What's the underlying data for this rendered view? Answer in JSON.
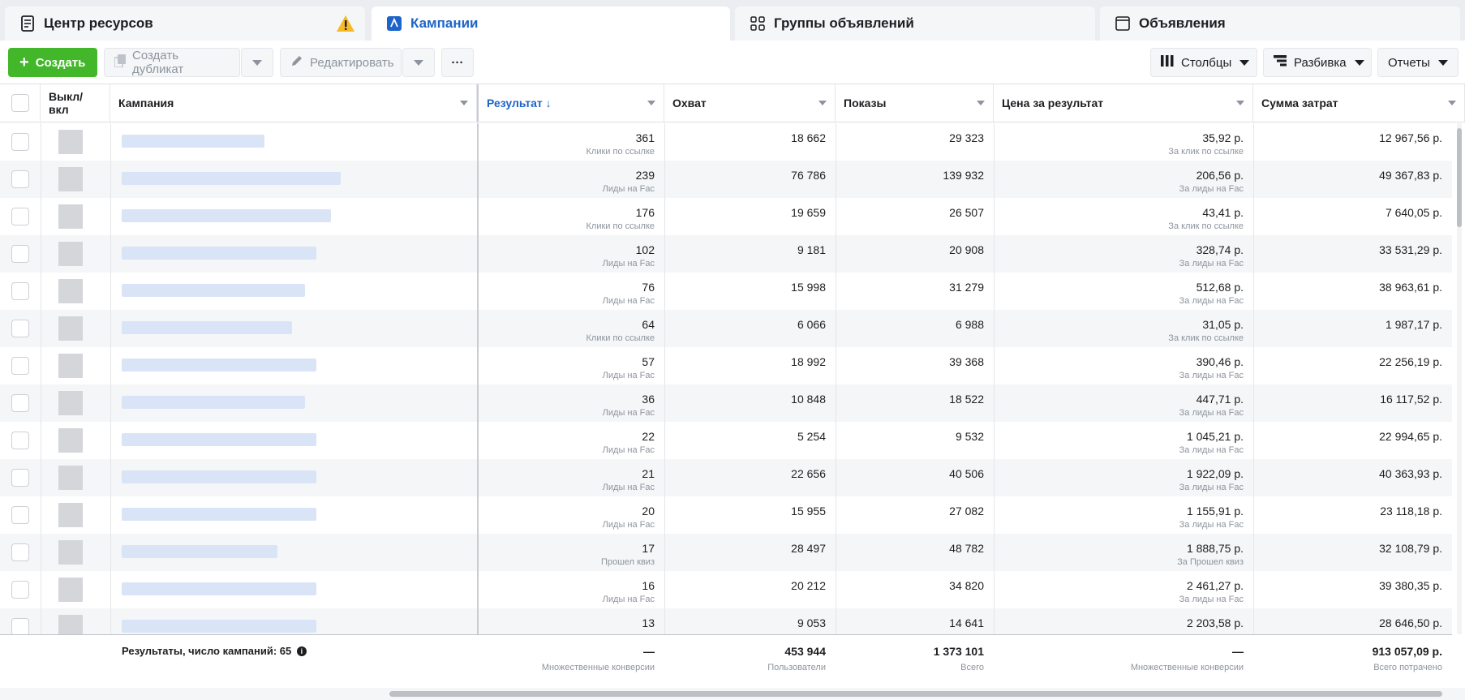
{
  "tabs": [
    {
      "label": "Центр ресурсов",
      "icon": "document-icon"
    },
    {
      "label": "Кампании",
      "icon": "campaign-icon"
    },
    {
      "label": "Группы объявлений",
      "icon": "grid-icon"
    },
    {
      "label": "Объявления",
      "icon": "ad-icon"
    }
  ],
  "toolbar": {
    "create": "Создать",
    "duplicate": "Создать дубликат",
    "edit": "Редактировать",
    "more": "···",
    "columns": "Столбцы",
    "breakdown": "Разбивка",
    "reports": "Отчеты"
  },
  "columns": {
    "toggle": "Выкл/\nвкл",
    "campaign": "Кампания",
    "result": "Результат ↓",
    "reach": "Охват",
    "impressions": "Показы",
    "cost": "Цена за результат",
    "spend": "Сумма затрат"
  },
  "rows": [
    {
      "result": "361",
      "result_type": "Клики по ссылке",
      "reach": "18 662",
      "impressions": "29 323",
      "cost": "35,92 р.",
      "cost_type": "За клик по ссылке",
      "spend": "12 967,56 р."
    },
    {
      "result": "239",
      "result_type": "Лиды на Fac",
      "reach": "76 786",
      "impressions": "139 932",
      "cost": "206,56 р.",
      "cost_type": "За лиды на Fac",
      "spend": "49 367,83 р."
    },
    {
      "result": "176",
      "result_type": "Клики по ссылке",
      "reach": "19 659",
      "impressions": "26 507",
      "cost": "43,41 р.",
      "cost_type": "За клик по ссылке",
      "spend": "7 640,05 р."
    },
    {
      "result": "102",
      "result_type": "Лиды на Fac",
      "reach": "9 181",
      "impressions": "20 908",
      "cost": "328,74 р.",
      "cost_type": "За лиды на Fac",
      "spend": "33 531,29 р."
    },
    {
      "result": "76",
      "result_type": "Лиды на Fac",
      "reach": "15 998",
      "impressions": "31 279",
      "cost": "512,68 р.",
      "cost_type": "За лиды на Fac",
      "spend": "38 963,61 р."
    },
    {
      "result": "64",
      "result_type": "Клики по ссылке",
      "reach": "6 066",
      "impressions": "6 988",
      "cost": "31,05 р.",
      "cost_type": "За клик по ссылке",
      "spend": "1 987,17 р."
    },
    {
      "result": "57",
      "result_type": "Лиды на Fac",
      "reach": "18 992",
      "impressions": "39 368",
      "cost": "390,46 р.",
      "cost_type": "За лиды на Fac",
      "spend": "22 256,19 р."
    },
    {
      "result": "36",
      "result_type": "Лиды на Fac",
      "reach": "10 848",
      "impressions": "18 522",
      "cost": "447,71 р.",
      "cost_type": "За лиды на Fac",
      "spend": "16 117,52 р."
    },
    {
      "result": "22",
      "result_type": "Лиды на Fac",
      "reach": "5 254",
      "impressions": "9 532",
      "cost": "1 045,21 р.",
      "cost_type": "За лиды на Fac",
      "spend": "22 994,65 р."
    },
    {
      "result": "21",
      "result_type": "Лиды на Fac",
      "reach": "22 656",
      "impressions": "40 506",
      "cost": "1 922,09 р.",
      "cost_type": "За лиды на Fac",
      "spend": "40 363,93 р."
    },
    {
      "result": "20",
      "result_type": "Лиды на Fac",
      "reach": "15 955",
      "impressions": "27 082",
      "cost": "1 155,91 р.",
      "cost_type": "За лиды на Fac",
      "spend": "23 118,18 р."
    },
    {
      "result": "17",
      "result_type": "Прошел квиз",
      "reach": "28 497",
      "impressions": "48 782",
      "cost": "1 888,75 р.",
      "cost_type": "За Прошел квиз",
      "spend": "32 108,79 р."
    },
    {
      "result": "16",
      "result_type": "Лиды на Fac",
      "reach": "20 212",
      "impressions": "34 820",
      "cost": "2 461,27 р.",
      "cost_type": "За лиды на Fac",
      "spend": "39 380,35 р."
    },
    {
      "result": "13",
      "result_type": "",
      "reach": "9 053",
      "impressions": "14 641",
      "cost": "2 203,58 р.",
      "cost_type": "",
      "spend": "28 646,50 р."
    }
  ],
  "footer": {
    "label": "Результаты, число кампаний: 65",
    "result": "—",
    "result_sub": "Множественные конверсии",
    "reach": "453 944",
    "reach_sub": "Пользователи",
    "impressions": "1 373 101",
    "impressions_sub": "Всего",
    "cost": "—",
    "cost_sub": "Множественные конверсии",
    "spend": "913 057,09 р.",
    "spend_sub": "Всего потрачено"
  },
  "colors": {
    "accent": "#1d64c8",
    "create_button": "#42b72a",
    "warning": "#f7b928"
  }
}
